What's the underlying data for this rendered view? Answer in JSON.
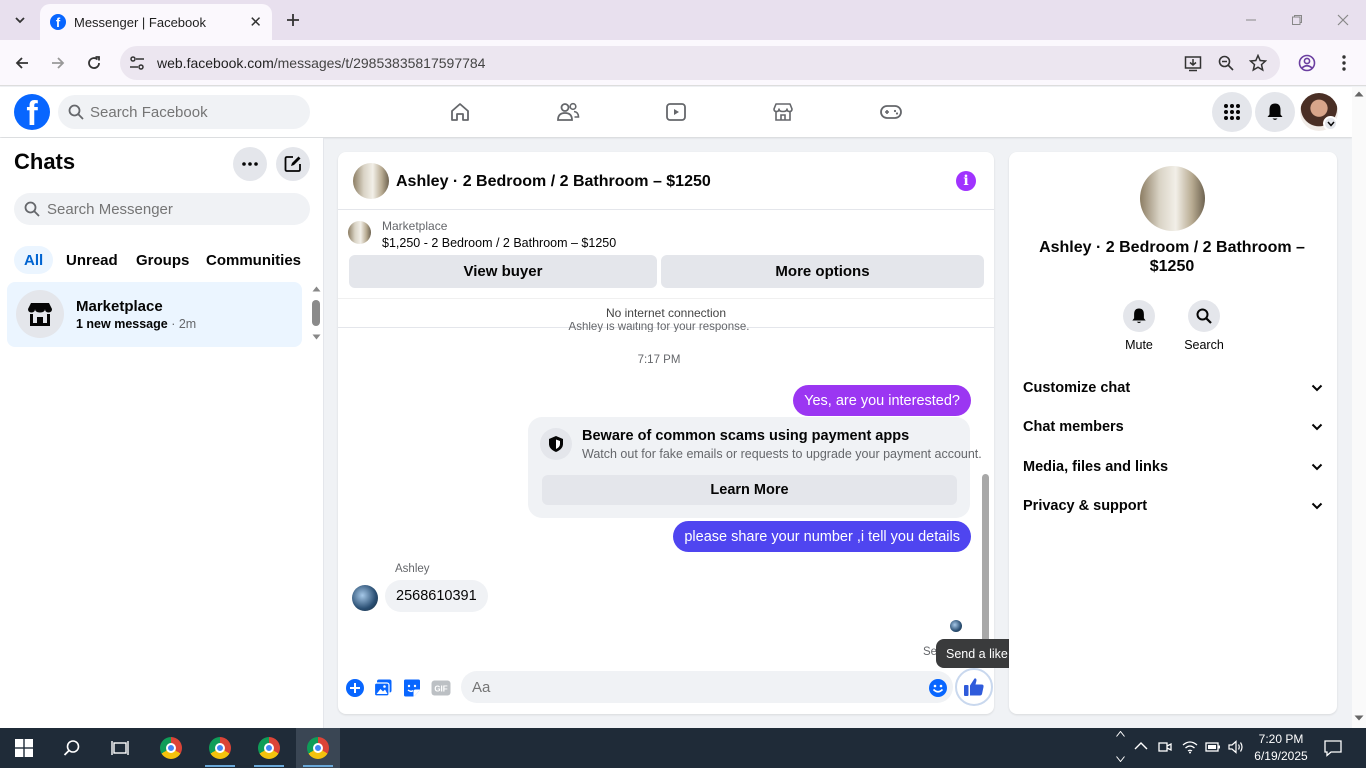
{
  "browser": {
    "tab_title": "Messenger | Facebook",
    "url_host": "web.facebook.com",
    "url_path": "/messages/t/29853835817597784"
  },
  "fb_header": {
    "search_placeholder": "Search Facebook"
  },
  "sidebar": {
    "title": "Chats",
    "search_placeholder": "Search Messenger",
    "filters": [
      "All",
      "Unread",
      "Groups",
      "Communities"
    ],
    "active_filter": "All",
    "conversations": [
      {
        "name": "Marketplace",
        "preview": "1 new message",
        "time": "· 2m"
      }
    ]
  },
  "conversation": {
    "title": "Ashley · 2 Bedroom / 2 Bathroom – $1250",
    "marketplace_label": "Marketplace",
    "marketplace_item": "$1,250 - 2 Bedroom / 2 Bathroom – $1250",
    "view_buyer": "View buyer",
    "more_options": "More options",
    "status": "No internet connection",
    "waiting_notice": "Ashley is waiting for your response.",
    "timestamp": "7:17 PM",
    "messages": [
      {
        "from": "me",
        "text": "Yes, are you interested?"
      },
      {
        "from": "me",
        "text": "please share your number ,i tell you details"
      },
      {
        "from": "Ashley",
        "text": "2568610391"
      }
    ],
    "warning": {
      "title": "Beware of common scams using payment apps",
      "text": "Watch out for fake emails or requests to upgrade your payment account.",
      "button": "Learn More"
    },
    "seen_label": "Se",
    "tooltip": "Send a like",
    "composer_placeholder": "Aa",
    "colors": {
      "bubble_1": "#9b36f2",
      "bubble_2": "#4f45f0",
      "like": "#2f5bdb"
    }
  },
  "info_panel": {
    "name": "Ashley · 2 Bedroom / 2 Bathroom – $1250",
    "actions": [
      "Mute",
      "Search"
    ],
    "sections": [
      "Customize chat",
      "Chat members",
      "Media, files and links",
      "Privacy & support"
    ]
  },
  "taskbar": {
    "time": "7:20 PM",
    "date": "6/19/2025"
  }
}
